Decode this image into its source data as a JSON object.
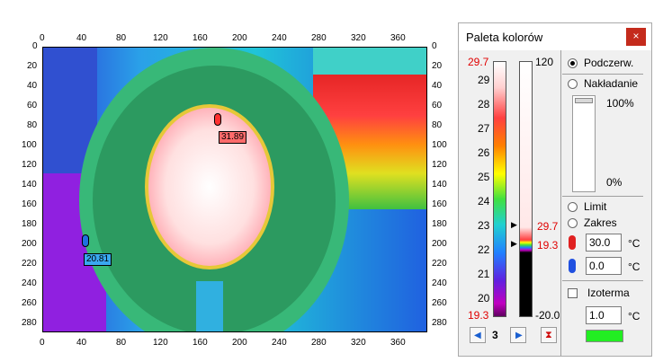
{
  "viewer": {
    "x_ticks": [
      "0",
      "40",
      "80",
      "120",
      "160",
      "200",
      "240",
      "280",
      "320",
      "360"
    ],
    "y_ticks": [
      "0",
      "20",
      "40",
      "60",
      "80",
      "100",
      "120",
      "140",
      "160",
      "180",
      "200",
      "220",
      "240",
      "260",
      "280"
    ],
    "markers": [
      {
        "label": "31.89",
        "color": "#ff6b6b"
      },
      {
        "label": "20.81",
        "color": "#3aa8f0"
      }
    ]
  },
  "palette": {
    "title": "Paleta kolorów",
    "close_label": "×",
    "scale_max": "29.7",
    "scale_min": "19.3",
    "scale_ticks": [
      "29",
      "28",
      "27",
      "26",
      "25",
      "24",
      "23",
      "22",
      "21",
      "20"
    ],
    "range_top": "120",
    "range_bottom": "-20.0",
    "range_hi": "29.7",
    "range_lo": "19.3",
    "palette_index": "3",
    "mode_ir": "Podczerw.",
    "mode_overlay": "Nakładanie",
    "overlay_max": "100%",
    "overlay_min": "0%",
    "limit_label": "Limit",
    "range_label": "Zakres",
    "max_value": "30.0",
    "min_value": "0.0",
    "unit": "°C",
    "isotherm_label": "Izoterma",
    "isotherm_value": "1.0",
    "isotherm_color": "#22ee22"
  }
}
